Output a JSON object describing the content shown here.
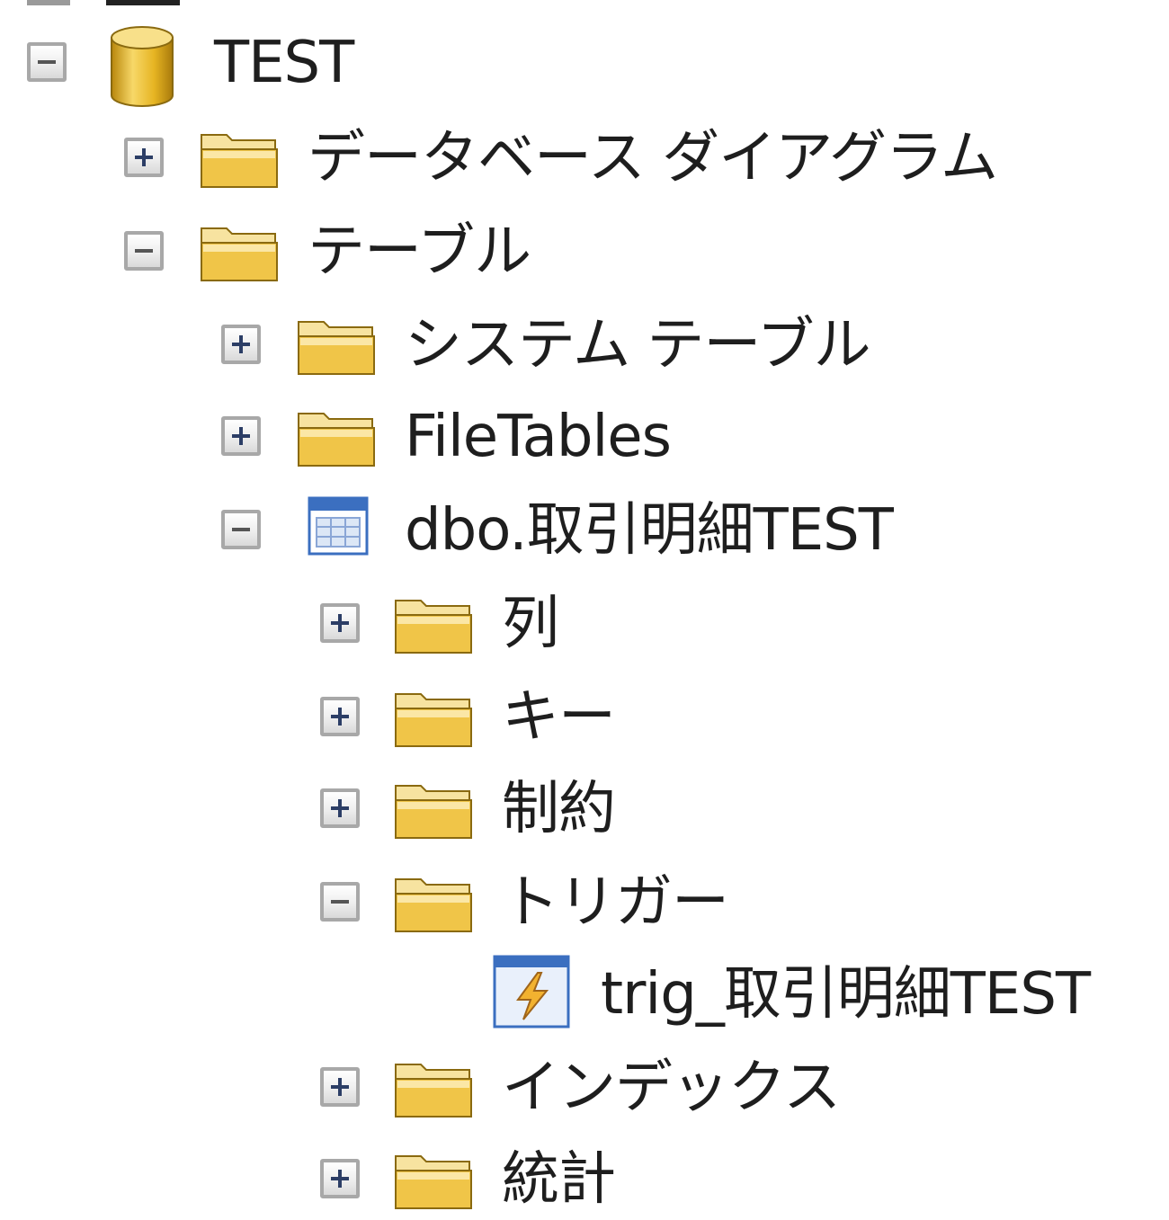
{
  "tree": {
    "nodes": [
      {
        "label": "TEST",
        "icon": "database-icon",
        "expander": "minus"
      },
      {
        "label": "データベース ダイアグラム",
        "icon": "folder-icon",
        "expander": "plus"
      },
      {
        "label": "テーブル",
        "icon": "folder-icon",
        "expander": "minus"
      },
      {
        "label": "システム テーブル",
        "icon": "folder-icon",
        "expander": "plus"
      },
      {
        "label": "FileTables",
        "icon": "folder-icon",
        "expander": "plus"
      },
      {
        "label": "dbo.取引明細TEST",
        "icon": "table-icon",
        "expander": "minus"
      },
      {
        "label": "列",
        "icon": "folder-icon",
        "expander": "plus"
      },
      {
        "label": "キー",
        "icon": "folder-icon",
        "expander": "plus"
      },
      {
        "label": "制約",
        "icon": "folder-icon",
        "expander": "plus"
      },
      {
        "label": "トリガー",
        "icon": "folder-icon",
        "expander": "minus"
      },
      {
        "label": "trig_取引明細TEST",
        "icon": "trigger-icon",
        "expander": "none"
      },
      {
        "label": "インデックス",
        "icon": "folder-icon",
        "expander": "plus"
      },
      {
        "label": "統計",
        "icon": "folder-icon",
        "expander": "plus"
      }
    ]
  },
  "colors": {
    "folder": "#f0c548",
    "folder_dark": "#c7951b",
    "database": "#e6b422",
    "table_blue": "#3b6fc0",
    "expander_border": "#a8a8a8"
  }
}
